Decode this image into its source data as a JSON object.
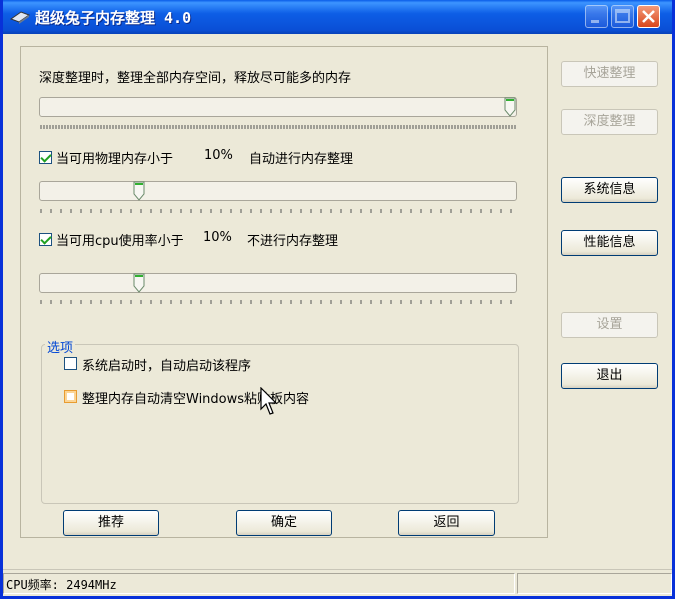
{
  "window": {
    "title": "超级兔子内存整理 4.0"
  },
  "deep": {
    "description": "深度整理时，整理全部内存空间，释放尽可能多的内存",
    "slider_value": 100
  },
  "memory": {
    "label_prefix": "当可用物理内存小于",
    "value": "10%",
    "label_suffix": "自动进行内存整理",
    "checked": true,
    "slider_value": 20
  },
  "cpu": {
    "label_prefix": "当可用cpu使用率小于",
    "value": "10%",
    "label_suffix": "不进行内存整理",
    "checked": true,
    "slider_value": 20
  },
  "options": {
    "title": "选项",
    "autostart_label": "系统启动时，自动启动该程序",
    "clear_clipboard_label": "整理内存自动清空Windows粘贴板内容"
  },
  "buttons": {
    "quick": "快速整理",
    "deep": "深度整理",
    "sysinfo": "系统信息",
    "perf": "性能信息",
    "settings": "设置",
    "exit": "退出",
    "recommend": "推荐",
    "ok": "确定",
    "back": "返回"
  },
  "status": {
    "cpu_freq": "CPU频率: 2494MHz"
  },
  "colors": {
    "titlebar": "#0a4fd6",
    "face": "#ece9d8",
    "group_title": "#0046d5",
    "close_button": "#d8461d"
  }
}
